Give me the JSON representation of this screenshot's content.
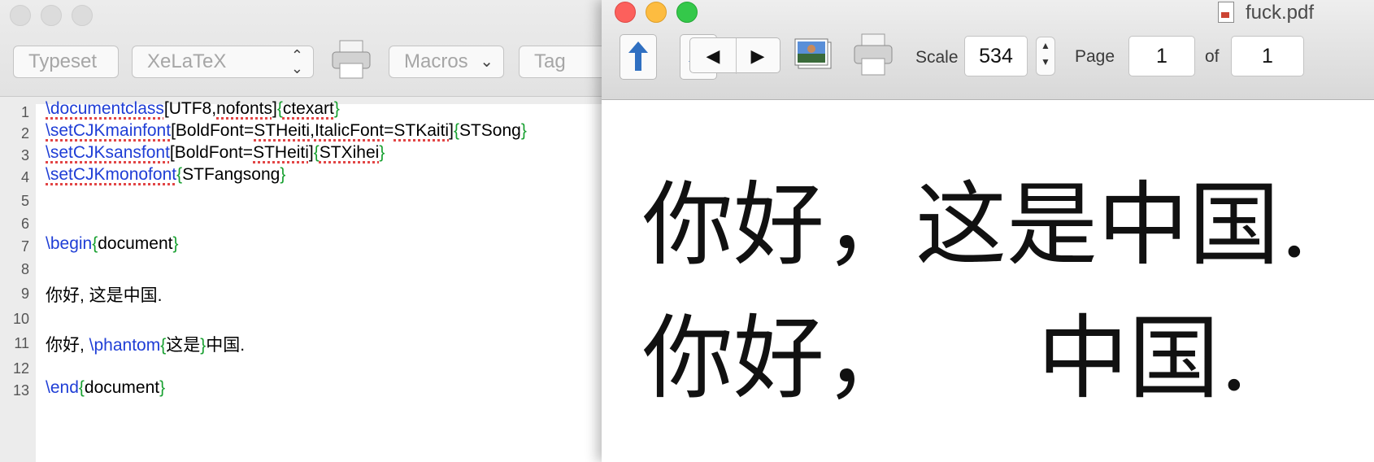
{
  "editor": {
    "toolbar": {
      "typeset_label": "Typeset",
      "engine_value": "XeLaTeX",
      "macros_label": "Macros",
      "tags_label": "Tag"
    },
    "line_numbers": [
      "1",
      "2",
      "3",
      "4",
      "5",
      "6",
      "7",
      "8",
      "9",
      "10",
      "11",
      "12",
      "13"
    ],
    "lines": {
      "l1": {
        "cmd": "\\documentclass",
        "a": "[UTF8,",
        "b": "nofonts",
        "c": "]",
        "d": "{",
        "e": "ctexart",
        "f": "}"
      },
      "l2": {
        "cmd": "\\setCJKmainfont",
        "a": "[BoldFont=",
        "b": "STHeiti",
        "c": ",",
        "d": "ItalicFont",
        "e": "=",
        "f": "STKaiti",
        "g": "]",
        "h": "{",
        "i": "STSong",
        "j": "}"
      },
      "l3": {
        "cmd": "\\setCJKsansfont",
        "a": "[BoldFont=",
        "b": "STHeiti",
        "c": "]",
        "d": "{",
        "e": "STXihei",
        "f": "}"
      },
      "l4": {
        "cmd": "\\setCJKmonofont",
        "a": "{",
        "b": "STFangsong",
        "c": "}"
      },
      "l7": {
        "cmd": "\\begin",
        "a": "{",
        "b": "document",
        "c": "}"
      },
      "l9": {
        "text": "你好, 这是中国."
      },
      "l11": {
        "a": "你好, ",
        "cmd": "\\phantom",
        "b": "{",
        "c": "这是",
        "d": "}",
        "e": "中国."
      },
      "l13": {
        "cmd": "\\end",
        "a": "{",
        "b": "document",
        "c": "}"
      }
    }
  },
  "pdf": {
    "title": "fuck.pdf",
    "scale_label": "Scale",
    "scale_value": "534",
    "page_label": "Page",
    "page_value": "1",
    "of_label": "of",
    "total_pages": "1",
    "content": {
      "line1": "你好，这是中国.",
      "line2a": "你好，",
      "line2b": "中国."
    }
  },
  "colors": {
    "command": "#1f3ed6",
    "brace": "#18a030",
    "spell_underline": "#e24545"
  }
}
